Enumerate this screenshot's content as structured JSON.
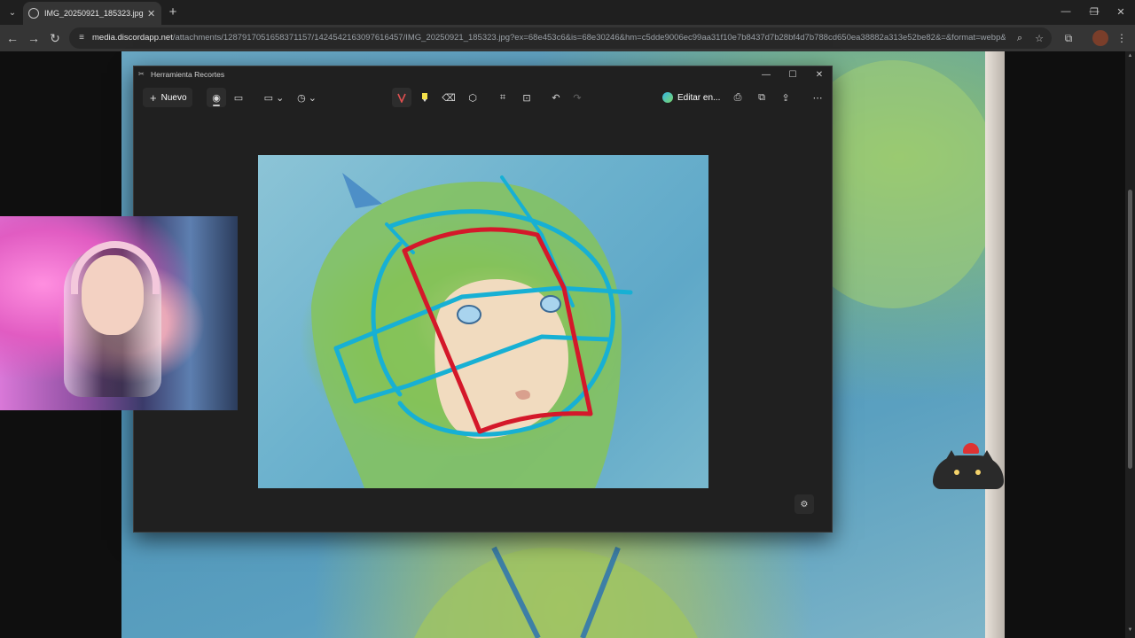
{
  "browser": {
    "tab": {
      "title": "IMG_20250921_185323.jpg (74..."
    },
    "url": {
      "host": "media.discordapp.net",
      "path": "/attachments/1287917051658371157/1424542163097616457/IMG_20250921_185323.jpg?ex=68e453c6&is=68e30246&hm=c5dde9006ec99aa31f10e7b8437d7b28bf4d7b788cd650ea38882a313e52be82&=&format=webp&widt..."
    }
  },
  "snipping_tool": {
    "title": "Herramienta Recortes",
    "toolbar": {
      "new_label": "Nuevo",
      "edit_in_label": "Editar en..."
    }
  },
  "colors": {
    "browser_bg": "#1f1f1f",
    "toolbar_bg": "#353535",
    "snip_bg": "#202020",
    "guide_cyan": "#17b0d4",
    "guide_red": "#d4182a"
  },
  "icons": {
    "tab_menu": "chevron-down-icon",
    "tab_favicon": "image-icon",
    "tab_close": "close-icon",
    "new_tab": "plus-icon",
    "back": "arrow-left-icon",
    "forward": "arrow-right-icon",
    "reload": "reload-icon",
    "site_info": "tune-icon",
    "zoom": "zoom-icon",
    "bookmark": "star-icon",
    "extensions": "puzzle-icon",
    "profile": "avatar-icon",
    "browser_menu": "kebab-icon",
    "snip_tools": [
      "camera-icon",
      "video-icon",
      "rectangle-icon",
      "clock-icon",
      "pen-icon",
      "highlighter-icon",
      "eraser-icon",
      "shapes-icon",
      "crop-icon",
      "text-actions-icon",
      "undo-icon",
      "redo-icon",
      "save-icon",
      "copy-icon",
      "share-icon",
      "more-icon"
    ]
  }
}
